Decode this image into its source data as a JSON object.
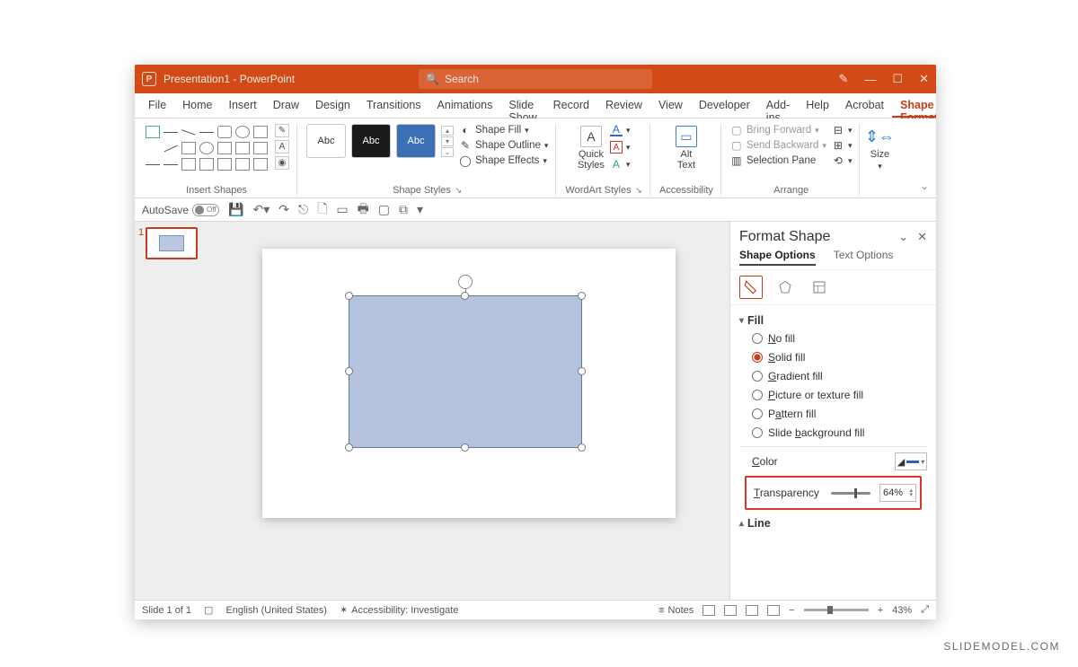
{
  "title": "Presentation1 - PowerPoint",
  "search_placeholder": "Search",
  "tabs": [
    "File",
    "Home",
    "Insert",
    "Draw",
    "Design",
    "Transitions",
    "Animations",
    "Slide Show",
    "Record",
    "Review",
    "View",
    "Developer",
    "Add-ins",
    "Help",
    "Acrobat",
    "Shape Format"
  ],
  "active_tab": "Shape Format",
  "ribbon": {
    "insert_shapes": "Insert Shapes",
    "shape_styles": "Shape Styles",
    "wordart_styles": "WordArt Styles",
    "accessibility": "Accessibility",
    "arrange": "Arrange",
    "size": "Size",
    "preset_label": "Abc",
    "shape_fill": "Shape Fill",
    "shape_outline": "Shape Outline",
    "shape_effects": "Shape Effects",
    "quick_styles": "Quick\nStyles",
    "alt_text": "Alt\nText",
    "bring_forward": "Bring Forward",
    "send_backward": "Send Backward",
    "selection_pane": "Selection Pane"
  },
  "qat": {
    "autosave": "AutoSave",
    "off": "Off"
  },
  "thumb_number": "1",
  "pane": {
    "title": "Format Shape",
    "tab_shape": "Shape Options",
    "tab_text": "Text Options",
    "fill": "Fill",
    "line": "Line",
    "no_fill": "No fill",
    "solid_fill": "Solid fill",
    "gradient_fill": "Gradient fill",
    "picture_fill": "Picture or texture fill",
    "pattern_fill": "Pattern fill",
    "slide_bg_fill": "Slide background fill",
    "color": "Color",
    "transparency": "Transparency",
    "transparency_value": "64%"
  },
  "status": {
    "slide": "Slide 1 of 1",
    "lang": "English (United States)",
    "access": "Accessibility: Investigate",
    "notes": "Notes",
    "zoom": "43%"
  },
  "watermark": "SLIDEMODEL.COM"
}
